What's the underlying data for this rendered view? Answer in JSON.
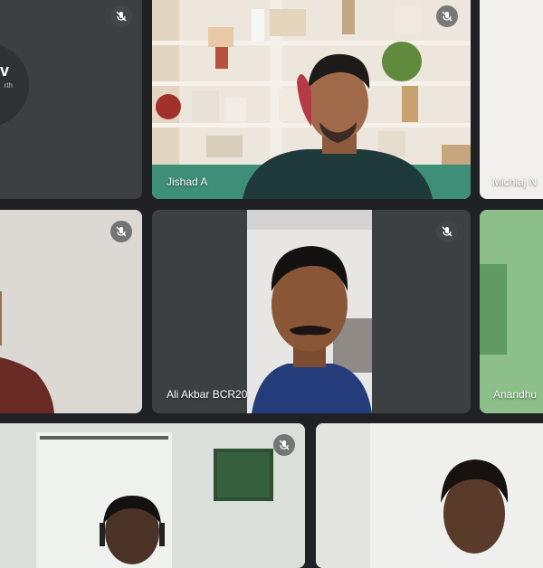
{
  "participants": [
    {
      "name": "",
      "avatar_initial": "v",
      "avatar_sub": "rth",
      "muted": true
    },
    {
      "name": "Jishad A",
      "muted": true
    },
    {
      "name": "Michlaj N",
      "muted": false
    },
    {
      "name": "",
      "muted": true
    },
    {
      "name": "Ali Akbar BCR20",
      "muted": true
    },
    {
      "name": "Anandhu",
      "muted": false
    },
    {
      "name": "",
      "muted": true
    },
    {
      "name": "",
      "muted": false
    }
  ],
  "colors": {
    "background": "#202124",
    "tile_dark": "#3c4043",
    "name_text": "#ffffff"
  },
  "icons": {
    "mute": "mic-off-icon"
  }
}
